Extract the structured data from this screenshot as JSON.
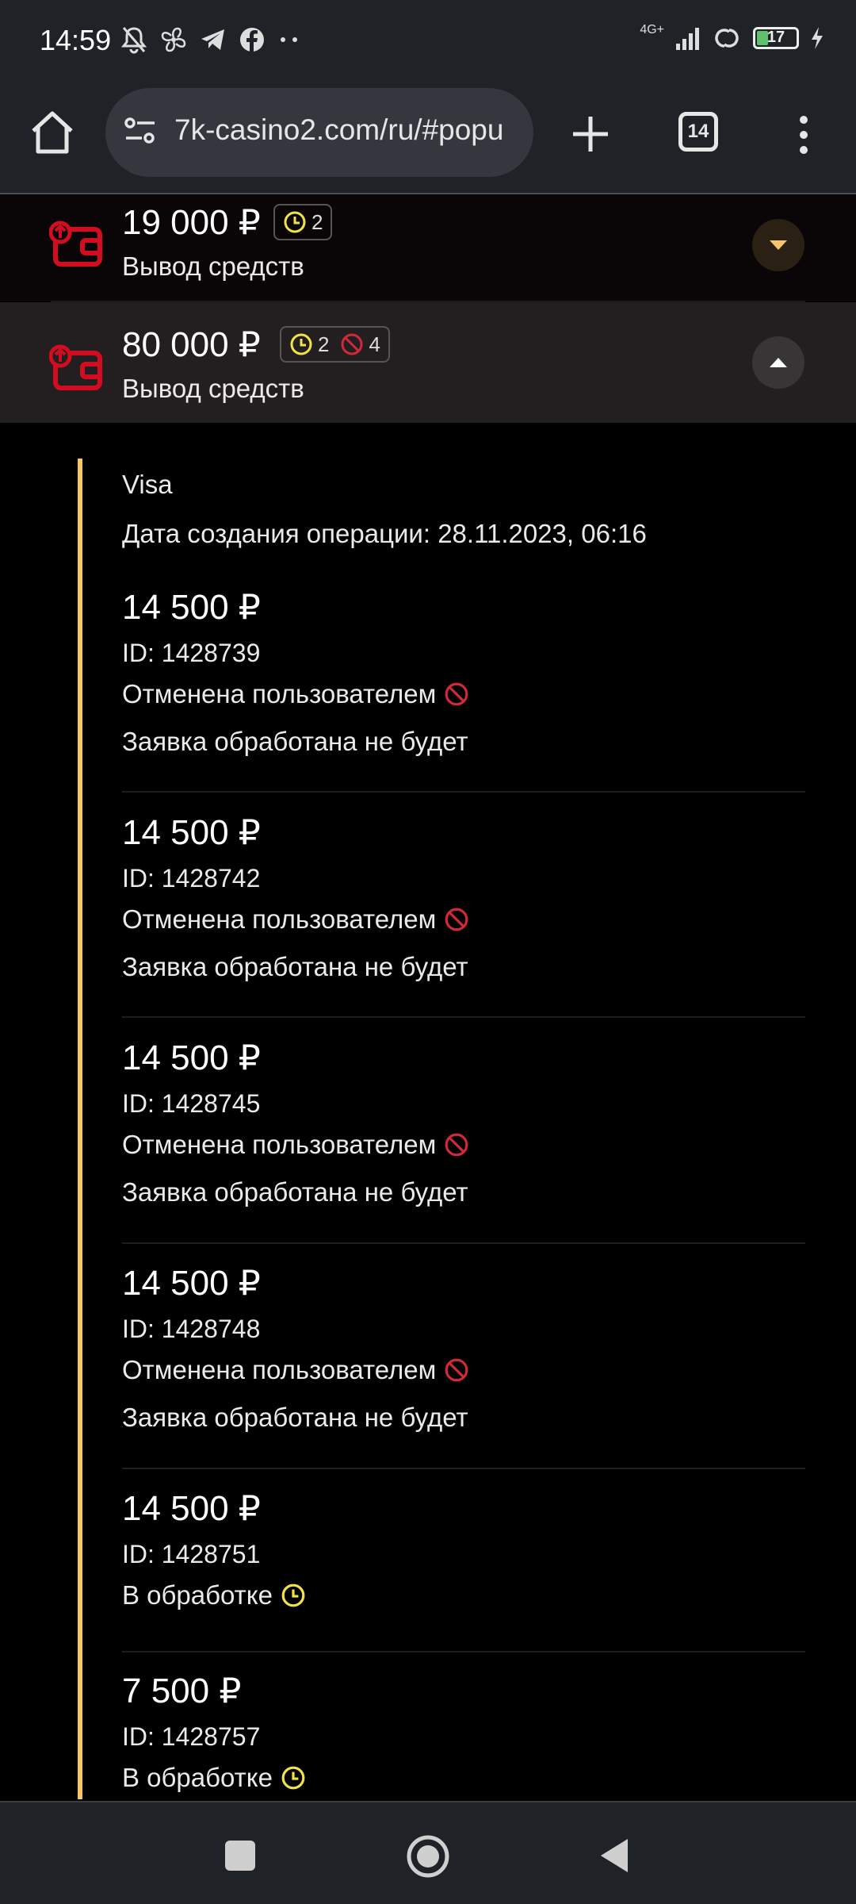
{
  "status_bar": {
    "time": "14:59",
    "network_type": "4G+",
    "battery_level": "17",
    "icons": [
      "dnd-bell-off-icon",
      "fan-icon",
      "telegram-icon",
      "facebook-icon",
      "more-dots-icon",
      "signal-icon",
      "link-icon",
      "battery-icon",
      "charging-icon"
    ]
  },
  "browser": {
    "url": "7k-casino2.com/ru/#popu",
    "tab_count": "14"
  },
  "withdrawals": [
    {
      "amount": "19 000 ₽",
      "label": "Вывод средств",
      "pending_count": "2",
      "toggle": "chevron-down-icon"
    },
    {
      "amount": "80 000 ₽",
      "label": "Вывод средств",
      "pending_count": "2",
      "cancelled_count": "4",
      "toggle": "chevron-up-icon"
    }
  ],
  "details": {
    "method": "Visa",
    "created": "Дата создания операции: 28.11.2023, 06:16",
    "operations": [
      {
        "amount": "14 500 ₽",
        "id": "ID: 1428739",
        "status": "Отменена пользователем",
        "status_type": "cancelled",
        "note": "Заявка обработана не будет"
      },
      {
        "amount": "14 500 ₽",
        "id": "ID: 1428742",
        "status": "Отменена пользователем",
        "status_type": "cancelled",
        "note": "Заявка обработана не будет"
      },
      {
        "amount": "14 500 ₽",
        "id": "ID: 1428745",
        "status": "Отменена пользователем",
        "status_type": "cancelled",
        "note": "Заявка обработана не будет"
      },
      {
        "amount": "14 500 ₽",
        "id": "ID: 1428748",
        "status": "Отменена пользователем",
        "status_type": "cancelled",
        "note": "Заявка обработана не будет"
      },
      {
        "amount": "14 500 ₽",
        "id": "ID: 1428751",
        "status": "В обработке",
        "status_type": "pending"
      },
      {
        "amount": "7 500 ₽",
        "id": "ID: 1428757",
        "status": "В обработке",
        "status_type": "pending"
      }
    ]
  },
  "colors": {
    "accent_gold": "#f7c56c",
    "cancel_red": "#d0293a",
    "pending_yellow": "#f2e24a",
    "wallet_red": "#d10d1f"
  }
}
